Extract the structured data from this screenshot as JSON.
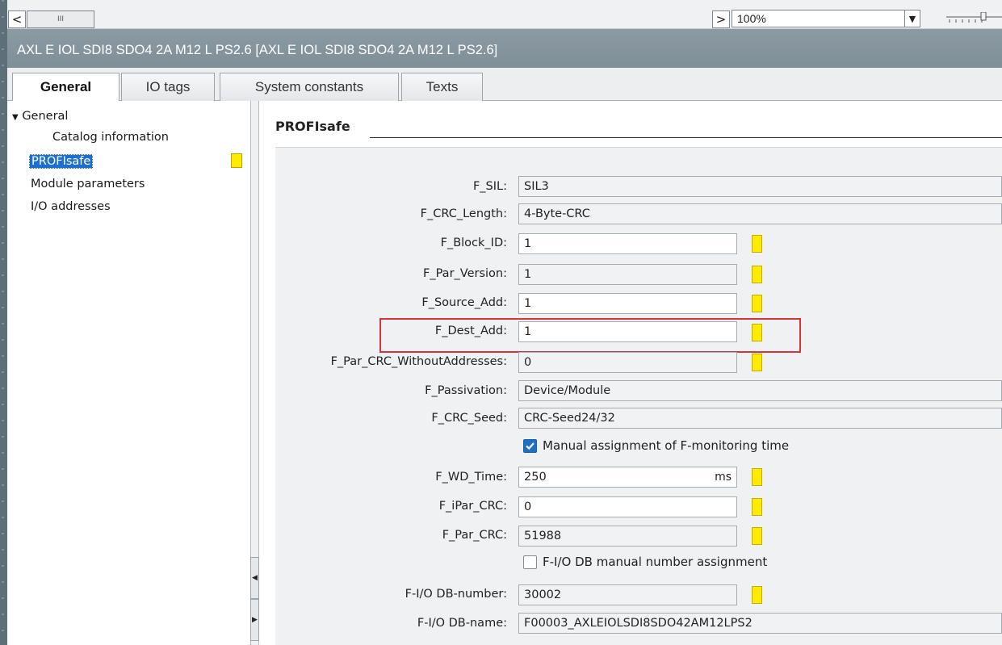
{
  "toolbar": {
    "scroll_left": "<",
    "scroll_grip": "III",
    "scroll_right": ">",
    "zoom_value": "100%"
  },
  "window_title": "AXL E IOL SDI8 SDO4 2A M12 L PS2.6 [AXL E IOL SDI8 SDO4 2A M12 L PS2.6]",
  "tabs": [
    {
      "label": "General"
    },
    {
      "label": "IO tags"
    },
    {
      "label": "System constants"
    },
    {
      "label": "Texts"
    }
  ],
  "nav": {
    "items": [
      {
        "label": "General",
        "expanded": true
      },
      {
        "label": "Catalog information"
      },
      {
        "label": "PROFIsafe",
        "selected": true
      },
      {
        "label": "Module parameters"
      },
      {
        "label": "I/O addresses"
      }
    ]
  },
  "section": {
    "title": "PROFIsafe"
  },
  "params": [
    {
      "label": "F_SIL:",
      "value": "SIL3"
    },
    {
      "label": "F_CRC_Length:",
      "value": "4-Byte-CRC"
    },
    {
      "label": "F_Block_ID:",
      "value": "1"
    },
    {
      "label": "F_Par_Version:",
      "value": "1"
    },
    {
      "label": "F_Source_Add:",
      "value": "1"
    },
    {
      "label": "F_Dest_Add:",
      "value": "1"
    },
    {
      "label": "F_Par_CRC_WithoutAddresses:",
      "value": "0"
    },
    {
      "label": "F_Passivation:",
      "value": "Device/Module"
    },
    {
      "label": "F_CRC_Seed:",
      "value": "CRC-Seed24/32"
    },
    {
      "label": "F_WD_Time:",
      "value": "250",
      "unit": "ms"
    },
    {
      "label": "F_iPar_CRC:",
      "value": "0"
    },
    {
      "label": "F_Par_CRC:",
      "value": "51988"
    },
    {
      "label": "F-I/O DB-number:",
      "value": "30002"
    },
    {
      "label": "F-I/O DB-name:",
      "value": "F00003_AXLEIOLSDI8SDO42AM12LPS2"
    }
  ],
  "checkboxes": {
    "manual_monitoring": {
      "label": "Manual assignment of F-monitoring time",
      "checked": true
    },
    "db_manual_number": {
      "label": "F-I/O DB manual number assignment",
      "checked": false
    }
  },
  "colors": {
    "marker": "#ffeb00",
    "selection": "#1c6fcf",
    "highlight": "#d4363b",
    "titlebar": "#8595a0"
  }
}
